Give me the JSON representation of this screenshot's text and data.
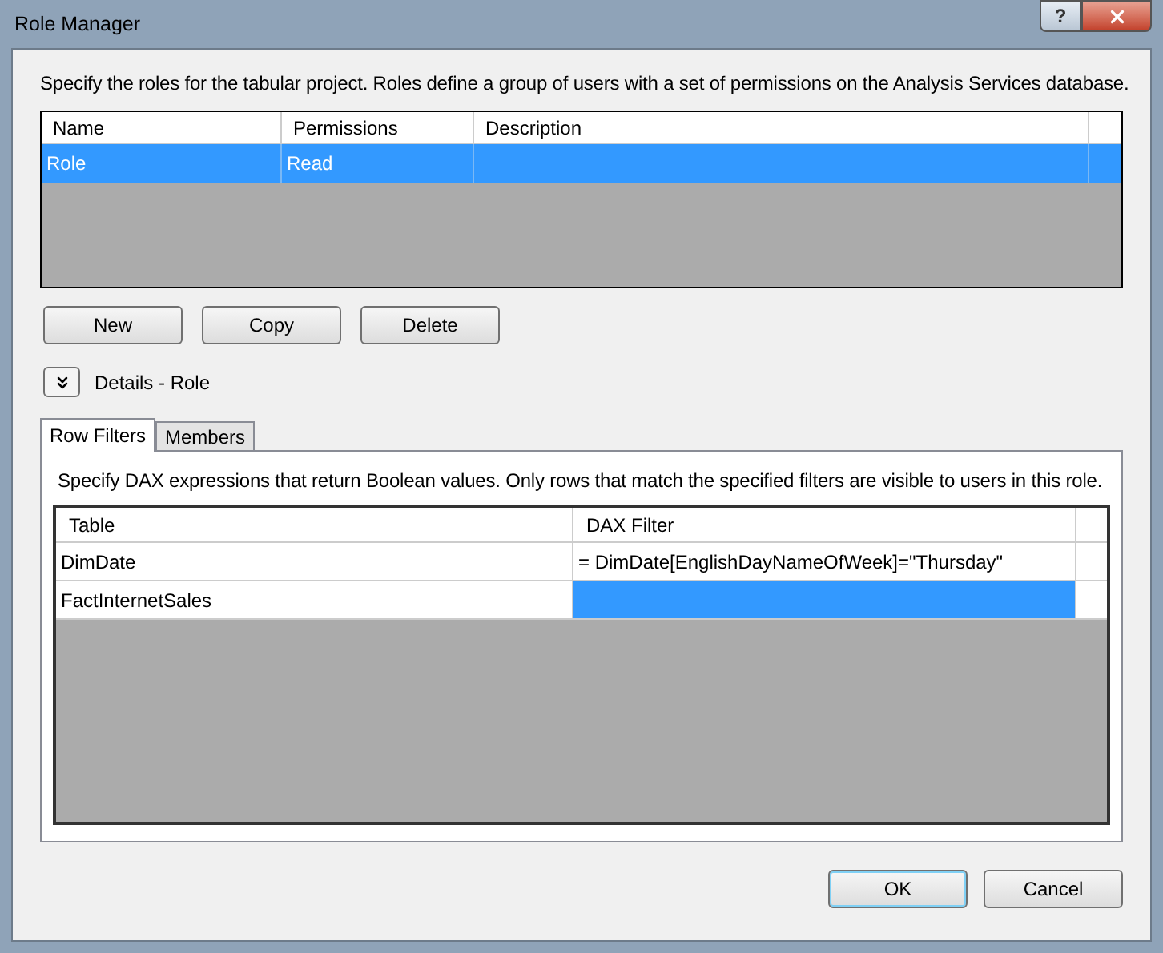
{
  "window": {
    "title": "Role Manager",
    "help": "?"
  },
  "intro": "Specify the roles for the tabular project. Roles define a group of users with a set of permissions on the Analysis Services database.",
  "roles": {
    "columns": [
      "Name",
      "Permissions",
      "Description"
    ],
    "rows": [
      {
        "name": "Role",
        "permissions": "Read",
        "description": "",
        "selected": true
      }
    ]
  },
  "role_buttons": [
    "New",
    "Copy",
    "Delete"
  ],
  "details": {
    "label": "Details - Role",
    "expanded": true
  },
  "tabs": [
    {
      "label": "Row Filters",
      "selected": true
    },
    {
      "label": "Members",
      "selected": false
    }
  ],
  "filters_intro": "Specify DAX expressions that return Boolean values. Only rows that match the specified filters are visible to users in this role.",
  "filters": {
    "columns": [
      "Table",
      "DAX Filter"
    ],
    "rows": [
      {
        "table": "DimDate",
        "filter": "= DimDate[EnglishDayNameOfWeek]=\"Thursday\"",
        "selected": false
      },
      {
        "table": "FactInternetSales",
        "filter": "",
        "selected": true
      }
    ]
  },
  "dialog_buttons": [
    {
      "label": "OK",
      "default": true
    },
    {
      "label": "Cancel",
      "default": false
    }
  ]
}
